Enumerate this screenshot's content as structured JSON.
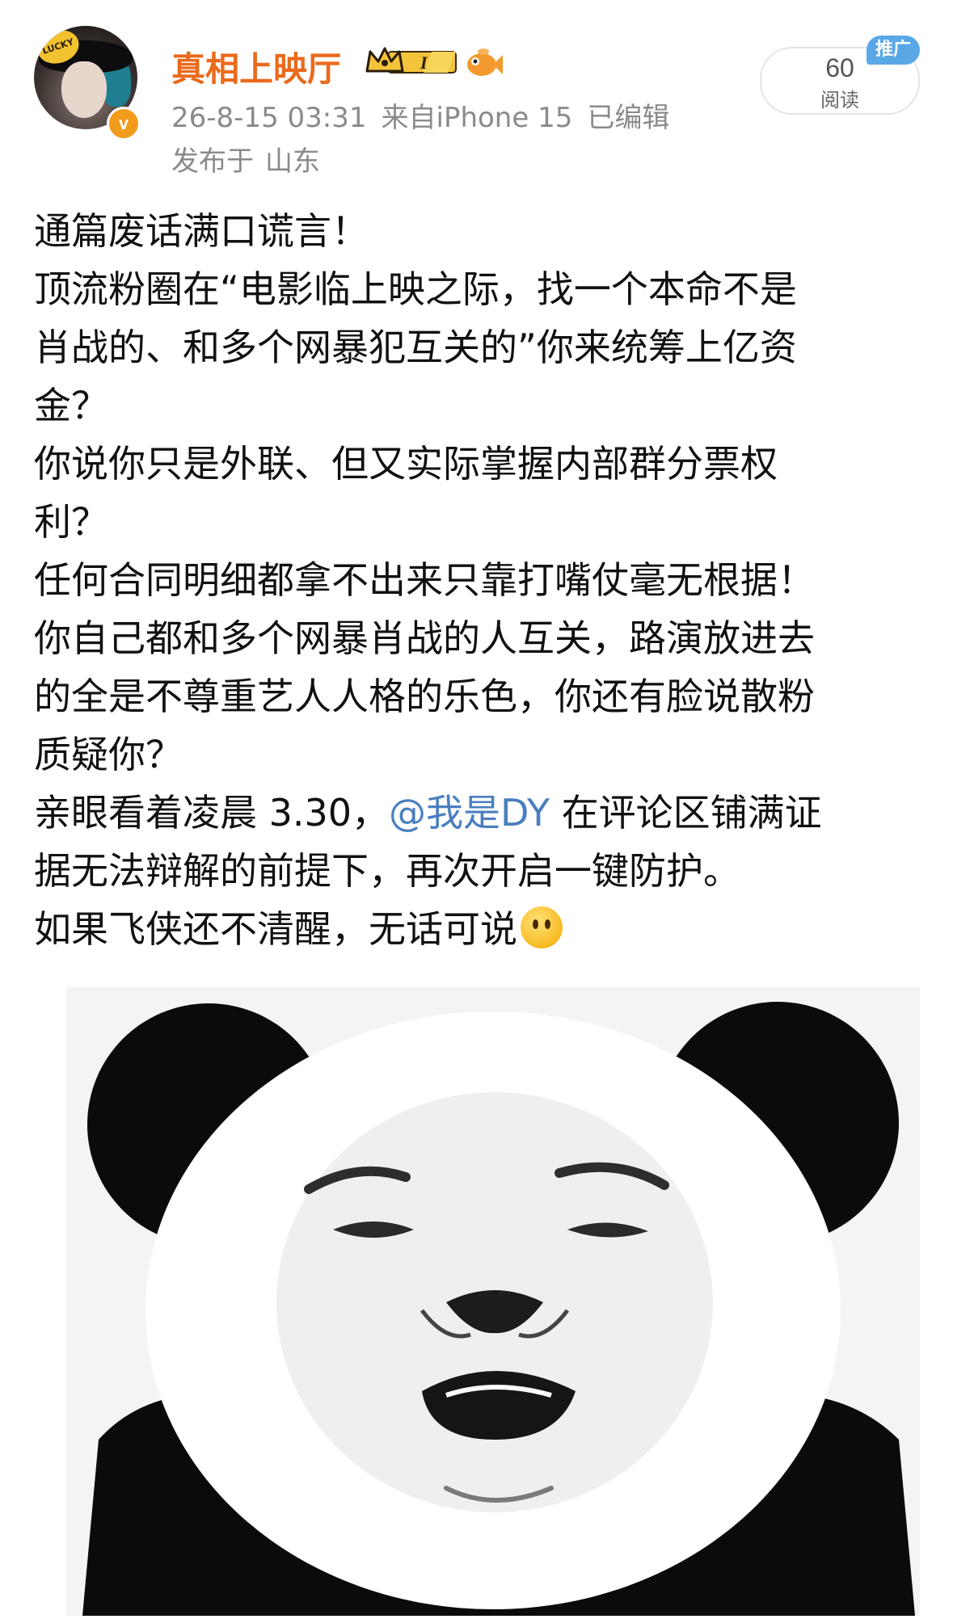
{
  "post": {
    "author": {
      "name": "真相上映厅",
      "avatar_badge_text": "LUCKY",
      "verified_mark": "v",
      "level_badge": "I"
    },
    "meta": {
      "time": "26-8-15 03:31",
      "source": "来自iPhone 15",
      "edited": "已编辑",
      "location_prefix": "发布于",
      "location": "山东"
    },
    "stats": {
      "read_count": "60",
      "read_label": "阅读",
      "promo_tag": "推广"
    },
    "body": {
      "line1": "通篇废话满口谎言！",
      "line2": "顶流粉圈在“电影临上映之际，找一个本命不是",
      "line3": "肖战的、和多个网暴犯互关的”你来统筹上亿资",
      "line4": "金？",
      "line5": "你说你只是外联、但又实际掌握内部群分票权",
      "line6": "利？",
      "line7": "任何合同明细都拿不出来只靠打嘴仗毫无根据！",
      "line8": "你自己都和多个网暴肖战的人互关，路演放进去",
      "line9": "的全是不尊重艺人人格的乐色，你还有脸说散粉",
      "line10": "质疑你？",
      "line11_before": "亲眼看着凌晨 3.30，",
      "line11_mention": "@我是DY",
      "line11_after": " 在评论区铺满证",
      "line12": "据无法辩解的前提下，再次开启一键防护。",
      "line13": "如果飞侠还不清醒，无话可说",
      "emoji": "hushed-face-emoji"
    },
    "image": {
      "subject": "panda-meme-image"
    }
  },
  "colors": {
    "username": "#ea6a1c",
    "meta_text": "#8a8a8a",
    "mention": "#4a7fbf",
    "promo_tag_bg": "#5aa7e6",
    "verified_badge": "#f39b1c"
  }
}
